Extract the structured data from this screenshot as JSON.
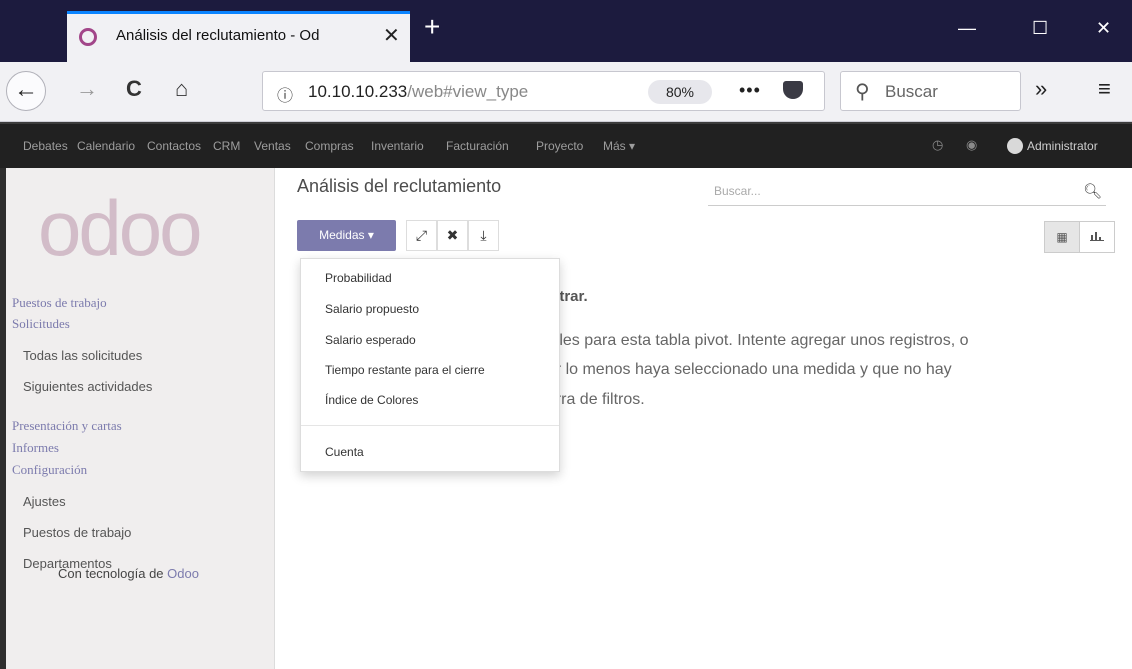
{
  "browser": {
    "tab_title": "Análisis del reclutamiento - Od",
    "tab_close": "✕",
    "new_tab": "+",
    "window_controls": {
      "minimize": "—",
      "maximize": "☐",
      "close": "✕"
    },
    "back": "←",
    "forward": "→",
    "reload": "C",
    "home": "⌂",
    "info_icon": "ⓘ",
    "url_main": "10.10.10.233",
    "url_path": "/web#view_type",
    "zoom": "80%",
    "more": "•••",
    "search_placeholder": "Buscar",
    "overflow": "»",
    "menu": "≡"
  },
  "topmenu": {
    "apps": [
      "Debates",
      "Calendario",
      "Contactos",
      "CRM",
      "Ventas",
      "Compras",
      "Inventario",
      "Facturación",
      "Proyecto",
      "Más ▾"
    ],
    "user": "Administrator"
  },
  "sidebar": {
    "logo": "odoo",
    "sections": [
      {
        "label": "Puestos de trabajo"
      },
      {
        "label": "Solicitudes"
      }
    ],
    "solicitudes_items": [
      "Todas las solicitudes",
      "Siguientes actividades"
    ],
    "sections2": [
      {
        "label": "Presentación y cartas"
      },
      {
        "label": "Informes"
      },
      {
        "label": "Configuración"
      }
    ],
    "config_items": [
      "Ajustes",
      "Puestos de trabajo",
      "Departamentos"
    ],
    "footer_prefix": "Con tecnología de",
    "footer_brand": "Odoo"
  },
  "control_panel": {
    "title": "Análisis del reclutamiento",
    "search_placeholder": "Buscar...",
    "measures_button": "Medidas ▾",
    "expand_icon": "⤢",
    "flip_icon": "✖",
    "download_icon": "⤓",
    "view_pivot_icon": "▦",
    "view_graph_icon": "📊"
  },
  "no_content": {
    "title": "strar.",
    "lines": [
      "nibles para esta tabla pivot. Intente agregar unos registros, o",
      "por lo menos haya seleccionado una medida y que no hay",
      "barra de filtros."
    ]
  },
  "measures_dropdown": {
    "items": [
      "Probabilidad",
      "Salario propuesto",
      "Salario esperado",
      "Tiempo restante para el cierre",
      "Índice de Colores"
    ],
    "count": "Cuenta"
  }
}
